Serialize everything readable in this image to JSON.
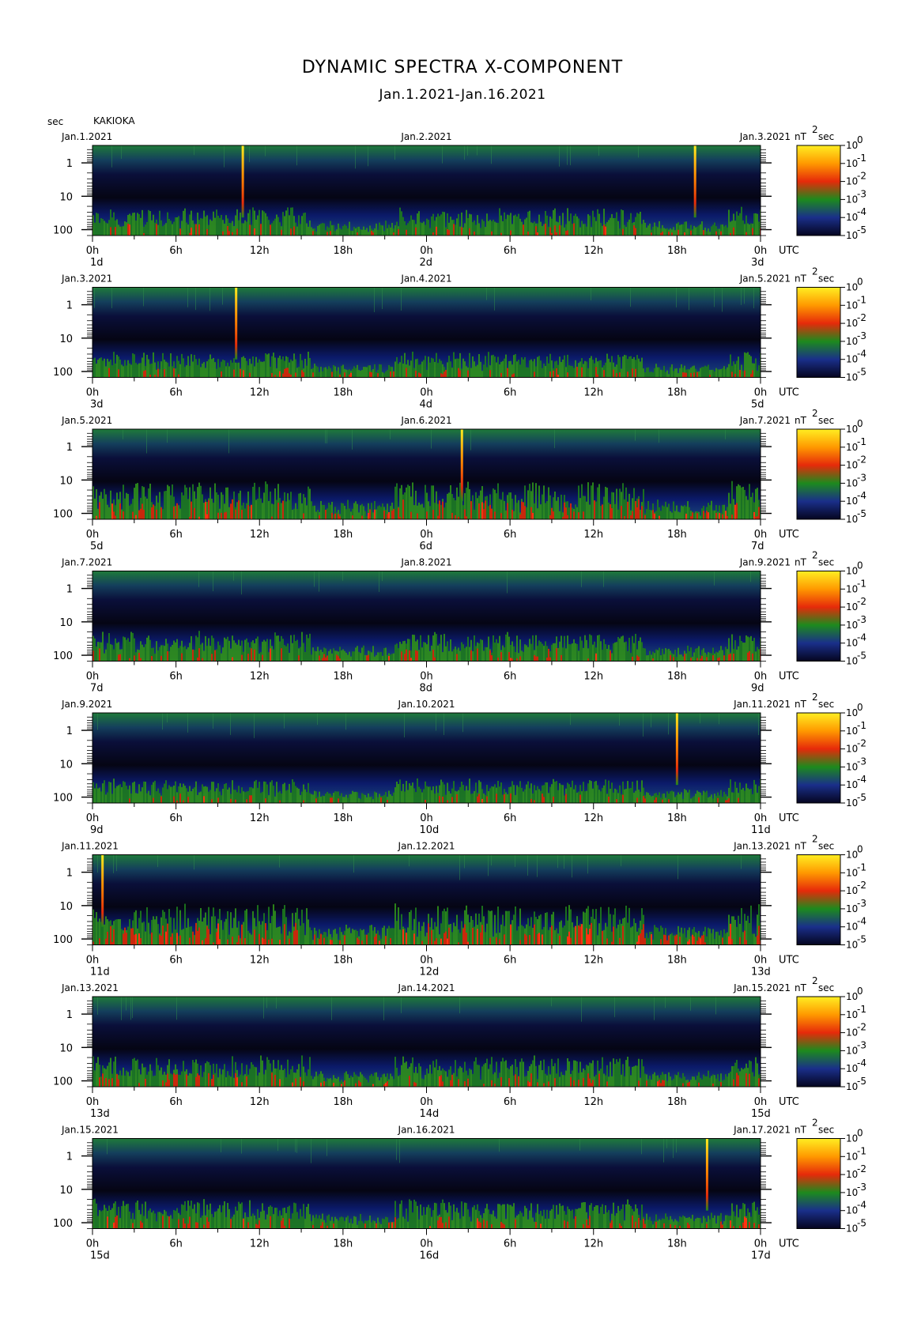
{
  "title": "DYNAMIC SPECTRA X-COMPONENT",
  "subtitle": "Jan.1.2021-Jan.16.2021",
  "y_unit_label": "sec",
  "station": "KAKIOKA",
  "colorbar_unit_label": "nT",
  "colorbar_unit_exp": "2",
  "colorbar_unit_suffix": "sec",
  "utc_label": "UTC",
  "chart_data": {
    "type": "heatmap",
    "ylabel": "sec",
    "y_scale": "log",
    "y_ticks": [
      "1",
      "10",
      "100"
    ],
    "x_ticks": [
      "0h",
      "6h",
      "12h",
      "18h",
      "0h",
      "6h",
      "12h",
      "18h",
      "0h"
    ],
    "colorbar": {
      "scale": "log",
      "colors": [
        "#050520",
        "#1a2f8a",
        "#1d8a1d",
        "#e62a0a",
        "#ff9900",
        "#ffee22"
      ],
      "tick_exponents": [
        "0",
        "-1",
        "-2",
        "-3",
        "-4",
        "-5"
      ]
    },
    "panels": [
      {
        "date_left": "Jan.1.2021",
        "date_mid": "Jan.2.2021",
        "date_right": "Jan.3.2021",
        "day_left": "1d",
        "day_mid": "2d",
        "day_right": "3d",
        "activity": 0.3,
        "spikes": [
          0.225,
          0.902
        ]
      },
      {
        "date_left": "Jan.3.2021",
        "date_mid": "Jan.4.2021",
        "date_right": "Jan.5.2021",
        "day_left": "3d",
        "day_mid": "4d",
        "day_right": "5d",
        "activity": 0.2,
        "spikes": [
          0.215
        ]
      },
      {
        "date_left": "Jan.5.2021",
        "date_mid": "Jan.6.2021",
        "date_right": "Jan.7.2021",
        "day_left": "5d",
        "day_mid": "6d",
        "day_right": "7d",
        "activity": 0.75,
        "spikes": [
          0.553
        ]
      },
      {
        "date_left": "Jan.7.2021",
        "date_mid": "Jan.8.2021",
        "date_right": "Jan.9.2021",
        "day_left": "7d",
        "day_mid": "8d",
        "day_right": "9d",
        "activity": 0.35,
        "spikes": []
      },
      {
        "date_left": "Jan.9.2021",
        "date_mid": "Jan.10.2021",
        "date_right": "Jan.11.2021",
        "day_left": "9d",
        "day_mid": "10d",
        "day_right": "11d",
        "activity": 0.15,
        "spikes": [
          0.875
        ]
      },
      {
        "date_left": "Jan.11.2021",
        "date_mid": "Jan.12.2021",
        "date_right": "Jan.13.2021",
        "day_left": "11d",
        "day_mid": "12d",
        "day_right": "13d",
        "activity": 0.85,
        "spikes": [
          0.015
        ]
      },
      {
        "date_left": "Jan.13.2021",
        "date_mid": "Jan.14.2021",
        "date_right": "Jan.15.2021",
        "day_left": "13d",
        "day_mid": "14d",
        "day_right": "15d",
        "activity": 0.4,
        "spikes": []
      },
      {
        "date_left": "Jan.15.2021",
        "date_mid": "Jan.16.2021",
        "date_right": "Jan.17.2021",
        "day_left": "15d",
        "day_mid": "16d",
        "day_right": "17d",
        "activity": 0.35,
        "spikes": [
          0.92
        ]
      }
    ]
  }
}
